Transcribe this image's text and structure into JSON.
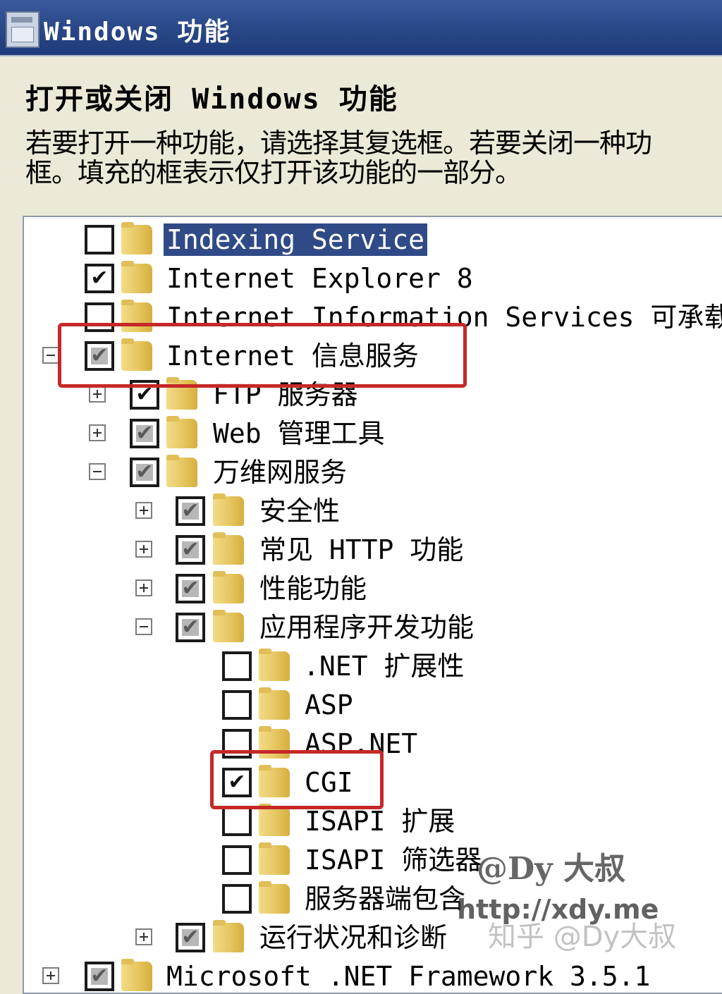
{
  "window": {
    "title": "Windows 功能",
    "icon": "windows-features-icon"
  },
  "heading": "打开或关闭 Windows 功能",
  "description": "若要打开一种功能，请选择其复选框。若要关闭一种功\n框。填充的框表示仅打开该功能的一部分。",
  "tree": {
    "items": [
      {
        "label": "Indexing Service",
        "state": "unchecked",
        "expander": "none",
        "selected": true
      },
      {
        "label": "Internet Explorer 8",
        "state": "checked",
        "expander": "none"
      },
      {
        "label": "Internet Information Services 可承载的",
        "state": "unchecked",
        "expander": "none"
      },
      {
        "label": "Internet 信息服务",
        "state": "partial",
        "expander": "minus",
        "highlighted": true
      },
      {
        "label": "FTP 服务器",
        "state": "checked",
        "expander": "plus"
      },
      {
        "label": "Web 管理工具",
        "state": "partial",
        "expander": "plus"
      },
      {
        "label": "万维网服务",
        "state": "partial",
        "expander": "minus"
      },
      {
        "label": "安全性",
        "state": "partial",
        "expander": "plus"
      },
      {
        "label": "常见 HTTP 功能",
        "state": "partial",
        "expander": "plus"
      },
      {
        "label": "性能功能",
        "state": "partial",
        "expander": "plus"
      },
      {
        "label": "应用程序开发功能",
        "state": "partial",
        "expander": "minus"
      },
      {
        "label": ".NET 扩展性",
        "state": "unchecked",
        "expander": "none"
      },
      {
        "label": "ASP",
        "state": "unchecked",
        "expander": "none"
      },
      {
        "label": "ASP.NET",
        "state": "unchecked",
        "expander": "none"
      },
      {
        "label": "CGI",
        "state": "checked",
        "expander": "none",
        "highlighted": true
      },
      {
        "label": "ISAPI 扩展",
        "state": "unchecked",
        "expander": "none"
      },
      {
        "label": "ISAPI 筛选器",
        "state": "unchecked",
        "expander": "none"
      },
      {
        "label": "服务器端包含",
        "state": "unchecked",
        "expander": "none"
      },
      {
        "label": "运行状况和诊断",
        "state": "partial",
        "expander": "plus"
      },
      {
        "label": "Microsoft .NET Framework 3.5.1",
        "state": "partial",
        "expander": "plus"
      }
    ]
  },
  "watermarks": {
    "line1": "@Dy 大叔",
    "line2": "http://xdy.me",
    "line3": "知乎 @Dy大叔"
  },
  "colors": {
    "highlight_box": "#c62828",
    "selection": "#2f4a86",
    "titlebar": "#2c4a8a"
  }
}
